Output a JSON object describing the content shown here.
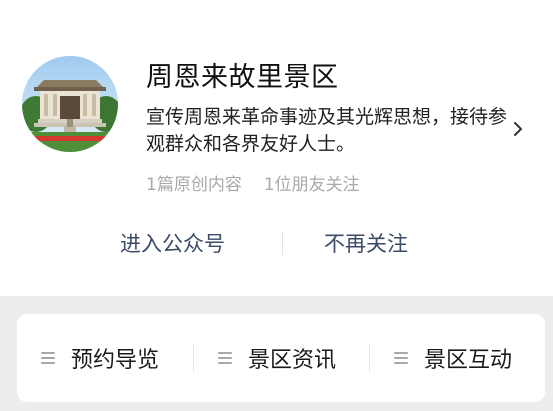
{
  "profile": {
    "name": "周恩来故里景区",
    "description": "宣传周恩来革命事迹及其光辉思想，接待参观群众和各界友好人士。",
    "stats": {
      "original_count": "1篇原创内容",
      "friends_following": "1位朋友关注"
    },
    "avatar_icon": "building-photo",
    "chevron_icon": "chevron-right-icon"
  },
  "actions": {
    "enter_label": "进入公众号",
    "unfollow_label": "不再关注"
  },
  "menu": {
    "items": [
      {
        "label": "预约导览",
        "icon": "menu-lines-icon"
      },
      {
        "label": "景区资讯",
        "icon": "menu-lines-icon"
      },
      {
        "label": "景区互动",
        "icon": "menu-lines-icon"
      }
    ]
  },
  "colors": {
    "page_background": "#ededed",
    "card_background": "#ffffff",
    "action_text": "#3b4a67",
    "muted_text": "#a9a9a9"
  }
}
